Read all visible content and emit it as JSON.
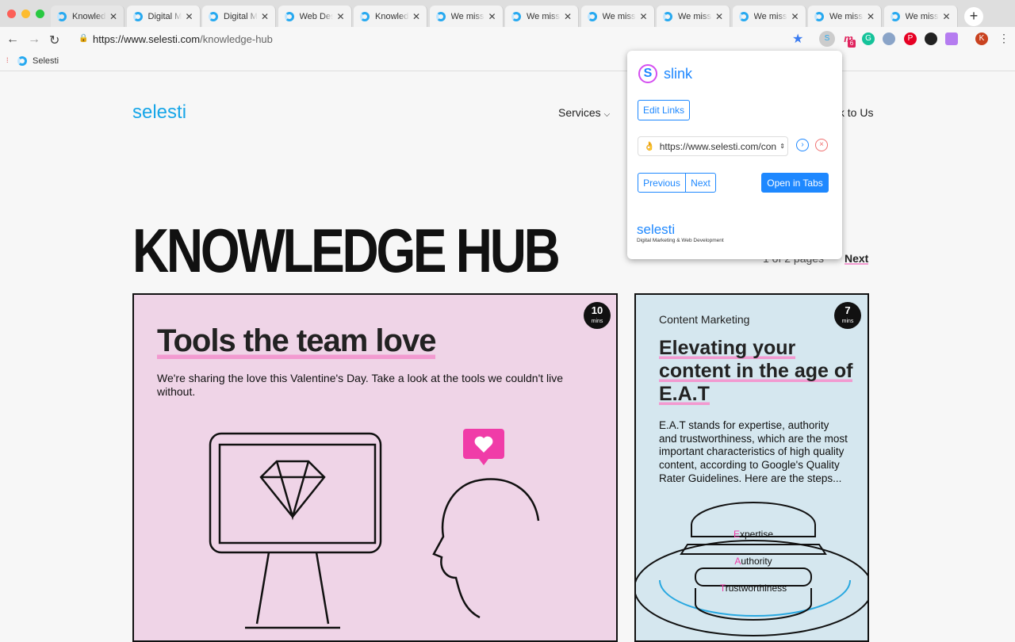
{
  "browser": {
    "tabs": [
      {
        "title": "Knowledge Hub",
        "active": true
      },
      {
        "title": "Digital Marketing"
      },
      {
        "title": "Digital Marketing"
      },
      {
        "title": "Web Design"
      },
      {
        "title": "Knowledge Hub"
      },
      {
        "title": "We miss you"
      },
      {
        "title": "We miss you"
      },
      {
        "title": "We miss you"
      },
      {
        "title": "We miss you"
      },
      {
        "title": "We miss you"
      },
      {
        "title": "We miss you"
      },
      {
        "title": "We miss you"
      }
    ],
    "new_tab": "+",
    "url_host": "https://www.selesti.com",
    "url_path": "/knowledge-hub",
    "bookmark": "Selesti",
    "avatar": "K",
    "extension_badge": "6"
  },
  "site": {
    "logo": "selesti",
    "nav": {
      "services": "Services",
      "talk": "Talk to Us"
    },
    "title": "KNOWLEDGE HUB",
    "pager": {
      "info": "1 of 2 pages",
      "next": "Next"
    },
    "cards": [
      {
        "mins": "10",
        "mins_label": "mins",
        "title": "Tools the team love",
        "text": "We're sharing the love this Valentine's Day. Take a look at the tools we couldn't live without."
      },
      {
        "mins": "7",
        "mins_label": "mins",
        "category": "Content Marketing",
        "title": "Elevating your content in the age of E.A.T",
        "text": "E.A.T stands for expertise, authority and trustworthiness, which are the most important characteristics of high quality content, according to Google's Quality Rater Guidelines. Here are the steps...",
        "burger": [
          {
            "first": "E",
            "rest": "xpertise"
          },
          {
            "first": "A",
            "rest": "uthority"
          },
          {
            "first": "T",
            "rest": "rustworthiness"
          }
        ]
      }
    ]
  },
  "popup": {
    "brand": "slink",
    "edit_links": "Edit Links",
    "select_value": "https://www.selesti.com/con",
    "select_emoji": "👌",
    "previous": "Previous",
    "next": "Next",
    "open_tabs": "Open in Tabs",
    "footer_logo": "selesti",
    "footer_tagline": "Digital Marketing & Web Development"
  },
  "colors": {
    "accent": "#1e88ff",
    "brand": "#17a6e8",
    "pink_card": "#efd4e7",
    "blue_card": "#d5e7ef",
    "underline": "#f29ad0"
  }
}
